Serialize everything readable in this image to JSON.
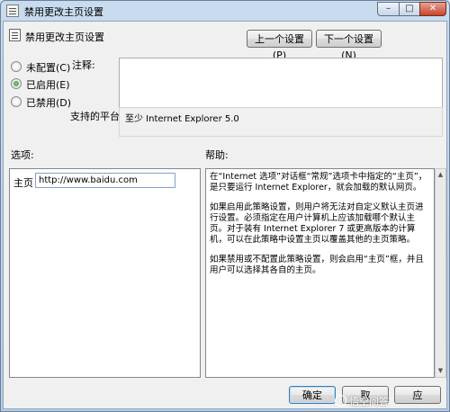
{
  "window": {
    "title": "禁用更改主页设置",
    "min_symbol": "–",
    "max_symbol": "□",
    "close_symbol": "✕"
  },
  "header": {
    "title": "禁用更改主页设置",
    "prev_button": "上一个设置(P)",
    "next_button": "下一个设置(N)"
  },
  "state": {
    "options": [
      {
        "label": "未配置(C)",
        "checked": false
      },
      {
        "label": "已启用(E)",
        "checked": true
      },
      {
        "label": "已禁用(D)",
        "checked": false
      }
    ]
  },
  "comment": {
    "label": "注释:",
    "value": ""
  },
  "platform": {
    "label": "支持的平台:",
    "value": "至少 Internet Explorer 5.0"
  },
  "sections": {
    "options_label": "选项:",
    "help_label": "帮助:"
  },
  "options_panel": {
    "homepage_label": "主页",
    "homepage_value": "http://www.baidu.com"
  },
  "help_panel": {
    "paragraphs": [
      "在“Internet 选项”对话框“常规”选项卡中指定的“主页”，是只要运行 Internet Explorer，就会加载的默认网页。",
      "如果启用此策略设置，则用户将无法对自定义默认主页进行设置。必须指定在用户计算机上应该加载哪个默认主页。对于装有 Internet Explorer 7 或更高版本的计算机，可以在此策略中设置主页以覆盖其他的主页策略。",
      "如果禁用或不配置此策略设置，则会启用“主页”框，并且用户可以选择其各自的主页。"
    ]
  },
  "footer": {
    "ok_button": "确定",
    "cancel_button": "取",
    "apply_button": "应"
  },
  "watermark": {
    "text": "悟空问答"
  },
  "scrollbar": {
    "up_arrow": "▲",
    "down_arrow": "▼"
  }
}
